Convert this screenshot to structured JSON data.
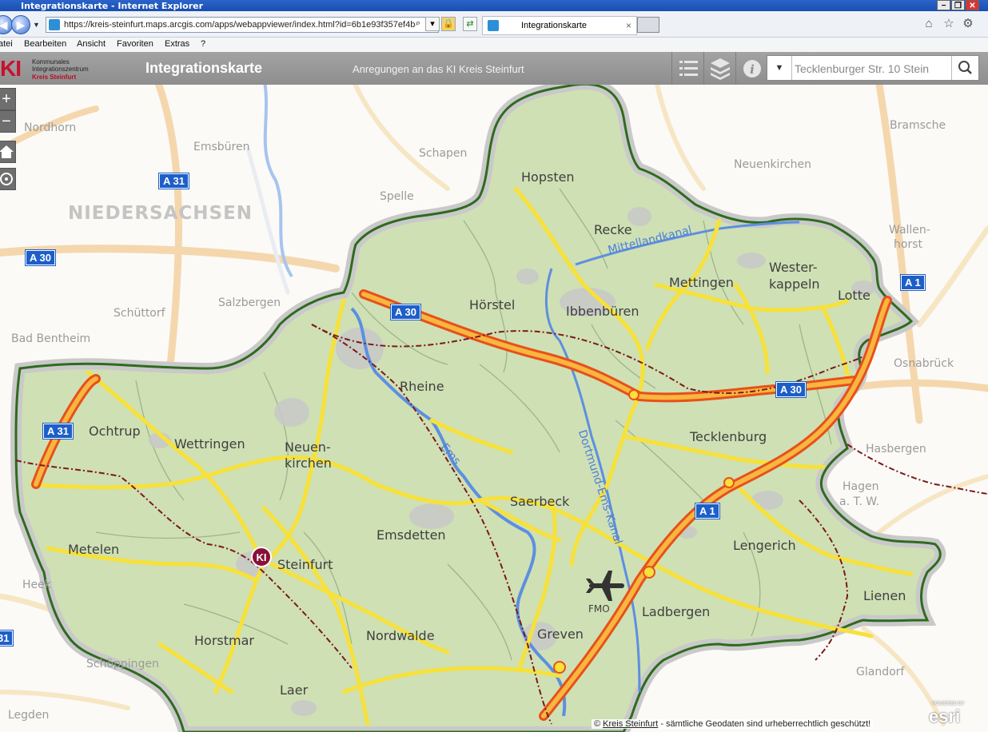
{
  "browser": {
    "title": "Integrationskarte - Internet Explorer",
    "url": "https://kreis-steinfurt.maps.arcgis.com/apps/webappviewer/index.html?id=6b1e93f357ef4b",
    "tab_title": "Integrationskarte",
    "tab_close": "×",
    "menu": [
      "atei",
      "Bearbeiten",
      "Ansicht",
      "Favoriten",
      "Extras",
      "?"
    ],
    "window_buttons": [
      "−",
      "❐",
      "✕"
    ]
  },
  "app": {
    "logo_mark": "KI",
    "logo_line1": "Kommunales",
    "logo_line2": "Integrationszentrum",
    "logo_line3": "Kreis Steinfurt",
    "title": "Integrationskarte",
    "feedback_link": "Anregungen an das KI Kreis Steinfurt",
    "search": {
      "value": "Tecklenburger Str. 10 Stein",
      "dropdown": "▼"
    },
    "header_icons": [
      "list-icon",
      "layers-icon",
      "info-icon",
      "search-icon"
    ]
  },
  "map": {
    "zoom_in": "+",
    "zoom_out": "−",
    "region_label": "NIEDERSACHSEN",
    "district_places": [
      "Hopsten",
      "Recke",
      "Mettingen",
      "Wester-",
      "kappeln",
      "Lotte",
      "Hörstel",
      "Ibbenbüren",
      "Rheine",
      "Ochtrup",
      "Wettringen",
      "Neuen-",
      "kirchen",
      "Tecklenburg",
      "Saerbeck",
      "Emsdetten",
      "Metelen",
      "Steinfurt",
      "Lengerich",
      "Lienen",
      "Ladbergen",
      "Greven",
      "FMO",
      "Horstmar",
      "Nordwalde",
      "Laer"
    ],
    "outer_places": [
      "Nordhorn",
      "Emsbüren",
      "Schapen",
      "Spelle",
      "Neuenkirchen",
      "Bramsche",
      "Wallen-",
      "horst",
      "Schüttorf",
      "Salzbergen",
      "Bad Bentheim",
      "Osnabrück",
      "Hasbergen",
      "Hagen",
      "a. T. W.",
      "Heek",
      "Schöppingen",
      "Legden",
      "Glandorf"
    ],
    "highway_shields": [
      "A 31",
      "A 30",
      "A 30",
      "A 30",
      "A 31",
      "A 1",
      "A 1",
      "31"
    ],
    "waterways": [
      "Mittellandkanal",
      "Ems",
      "Dortmund-Ems-Kanal"
    ],
    "marker_label": "KI",
    "attribution_prefix": "© ",
    "attribution_link": "Kreis Steinfurt",
    "attribution_text": " - sämtliche Geodaten sind urheberrechtlich geschützt!",
    "esri_powered": "POWERED BY",
    "esri_logo": "esri",
    "colors": {
      "district_fill": "#cfe0b4",
      "district_border": "#2f6b1e",
      "motorway": "#f08a1a",
      "main_road": "#f7e13a",
      "water": "#5d8fe0",
      "accent": "#c8102e"
    }
  }
}
